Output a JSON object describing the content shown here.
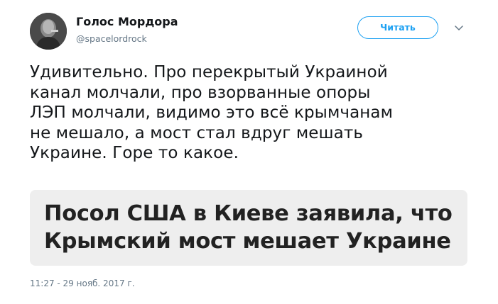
{
  "author": {
    "display_name": "Голос Мордора",
    "handle": "@spacelordrock",
    "avatar_icon": "user-avatar-icon"
  },
  "follow_button": {
    "label": "Читать",
    "color": "#1da1f2"
  },
  "caret_icon": "chevron-down-icon",
  "tweet": {
    "lines": [
      "Удивительно. Про перекрытый Украиной",
      "канал молчали, про взорванные опоры",
      "ЛЭП молчали, видимо это всё крымчанам",
      "не мешало, а мост стал вдруг мешать",
      "Украине. Горе то какое."
    ]
  },
  "media": {
    "lines": [
      "Посол США в Киеве заявила, что",
      "Крымский мост мешает Украине"
    ]
  },
  "timestamp": "11:27 - 29 нояб. 2017 г."
}
